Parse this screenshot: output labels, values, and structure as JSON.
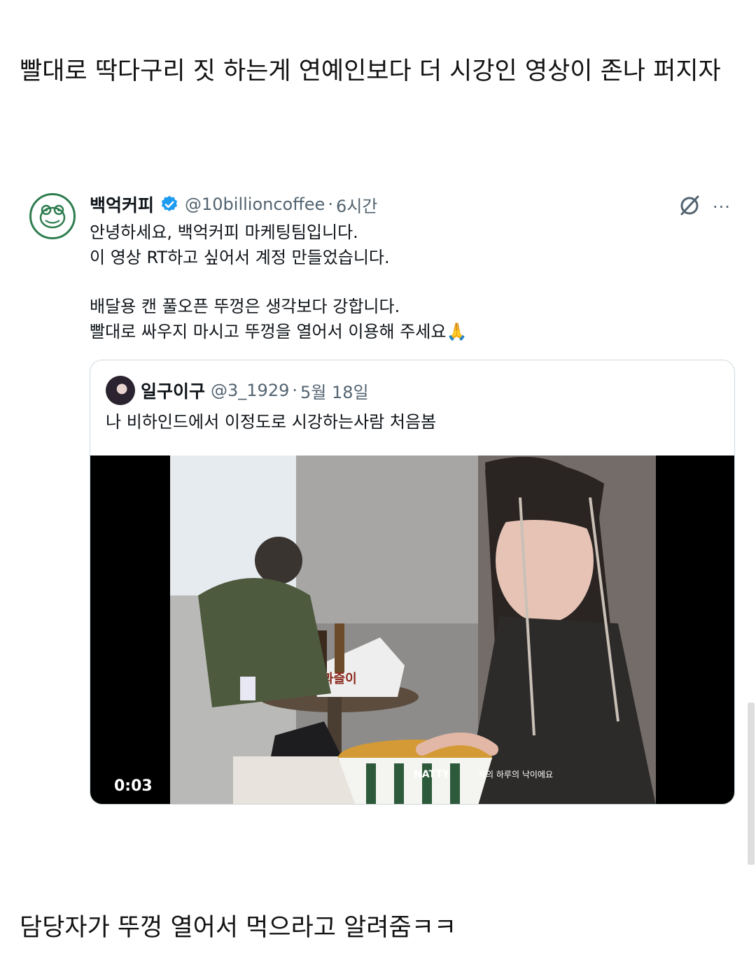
{
  "post": {
    "top_text": "빨대로 딱다구리 짓 하는게 연예인보다 더 시강인 영상이 존나 퍼지자",
    "bottom_text": "담당자가 뚜껑 열어서 먹으라고 알려줌ㅋㅋ"
  },
  "tweet": {
    "display_name": "백억커피",
    "handle": "@10billioncoffee",
    "dot": "·",
    "time": "6시간",
    "lines": [
      "안녕하세요, 백억커피 마케팅팀입니다.",
      "이 영상 RT하고 싶어서 계정 만들었습니다.",
      "",
      "배달용 캔 풀오픈 뚜껑은 생각보다 강합니다.",
      "빨대로 싸우지 마시고 뚜껑을 열어서 이용해 주세요🙏"
    ],
    "more_icon": "···"
  },
  "quote": {
    "display_name": "일구이구",
    "handle": "@3_1929",
    "dot": "·",
    "time": "5월 18일",
    "text": "나 비하인드에서 이정도로 시강하는사람 처음봄",
    "video": {
      "duration": "0:03",
      "cup_label": "과즐이",
      "brand_label": "NATTY",
      "caption": "저의 하루의 낙이에요"
    }
  },
  "colors": {
    "accent_green": "#2e7d4f",
    "verified_blue": "#1d9bf0",
    "muted_text": "#536471",
    "border": "#cfd9de"
  }
}
